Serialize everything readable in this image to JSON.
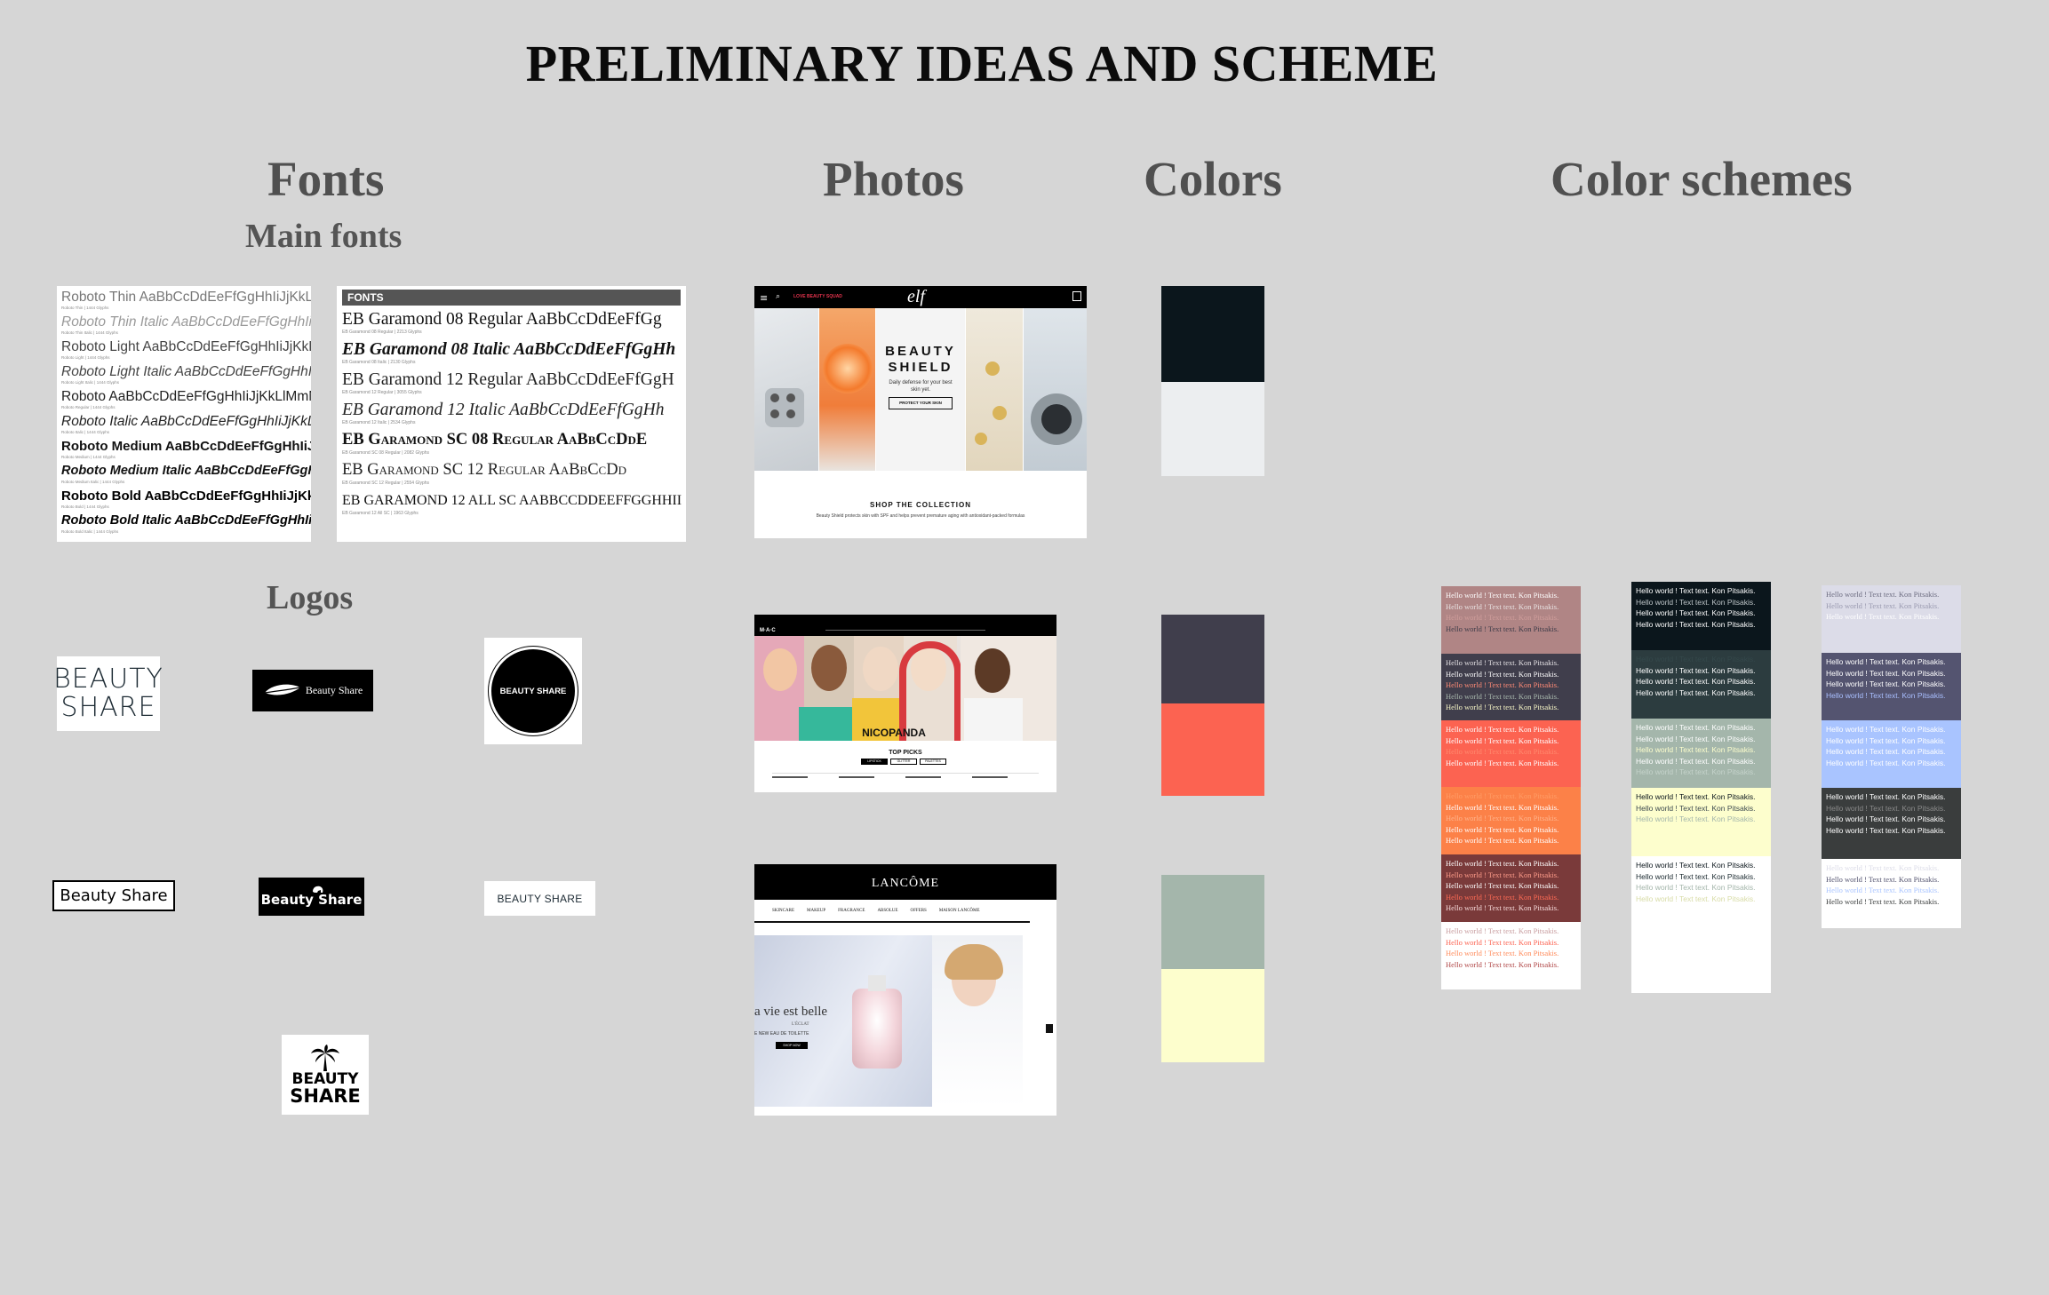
{
  "title": "PRELIMINARY IDEAS AND SCHEME",
  "sections": {
    "fonts": "Fonts",
    "main_fonts": "Main fonts",
    "logos": "Logos",
    "photos": "Photos",
    "colors": "Colors",
    "color_schemes": "Color schemes"
  },
  "roboto_card": {
    "lines": [
      {
        "text": "Roboto Thin AaBbCcDdEeFfGgHhIiJjKkLlM",
        "meta": "Roboto Thin | 1444 Glyphs"
      },
      {
        "text": "Roboto Thin Italic AaBbCcDdEeFfGgHhIiJjKk",
        "meta": "Roboto Thin Italic | 1444 Glyphs"
      },
      {
        "text": "Roboto Light AaBbCcDdEeFfGgHhIiJjKkLlM",
        "meta": "Roboto Light | 1444 Glyphs"
      },
      {
        "text": "Roboto Light Italic AaBbCcDdEeFfGgHhIiJjKkL",
        "meta": "Roboto Light Italic | 1444 Glyphs"
      },
      {
        "text": "Roboto AaBbCcDdEeFfGgHhIiJjKkLlMmNn",
        "meta": "Roboto Regular | 1444 Glyphs"
      },
      {
        "text": "Roboto Italic AaBbCcDdEeFfGgHhIiJjKkLlMm",
        "meta": "Roboto Italic | 1444 Glyphs"
      },
      {
        "text": "Roboto Medium AaBbCcDdEeFfGgHhIiJjKk",
        "meta": "Roboto Medium | 1444 Glyphs"
      },
      {
        "text": "Roboto Medium Italic AaBbCcDdEeFfGgHhIiJ",
        "meta": "Roboto Medium Italic | 1444 Glyphs"
      },
      {
        "text": "Roboto Bold AaBbCcDdEeFfGgHhIiJjKkLl",
        "meta": "Roboto Bold | 1444 Glyphs"
      },
      {
        "text": "Roboto Bold Italic AaBbCcDdEeFfGgHhIiJjKk",
        "meta": "Roboto Bold Italic | 1444 Glyphs"
      }
    ]
  },
  "eb_card": {
    "header": "FONTS",
    "lines": [
      {
        "text": "EB Garamond 08 Regular AaBbCcDdEeFfGg",
        "meta": "EB Garamond 08 Regular | 2213 Glyphs"
      },
      {
        "text": "EB Garamond 08 Italic AaBbCcDdEeFfGgHh",
        "meta": "EB Garamond 08 Italic | 2130 Glyphs"
      },
      {
        "text": "EB Garamond 12 Regular AaBbCcDdEeFfGgH",
        "meta": "EB Garamond 12 Regular | 3055 Glyphs"
      },
      {
        "text": "EB Garamond 12 Italic AaBbCcDdEeFfGgHh",
        "meta": "EB Garamond 12 Italic | 2534 Glyphs"
      },
      {
        "text": "EB Garamond SC 08 Regular AaBbCcDdE",
        "meta": "EB Garamond SC 08 Regular | 2082 Glyphs"
      },
      {
        "text": "EB Garamond SC 12 Regular AaBbCcDd",
        "meta": "EB Garamond SC 12 Regular | 2554 Glyphs"
      },
      {
        "text": "EB GARAMOND 12 ALL SC AABBCCDDEEFFGGHHII",
        "meta": "EB Garamond 12 All SC | 1963 Glyphs"
      }
    ]
  },
  "logos": {
    "logo1": "BEAUTY\nSHARE",
    "logo2": "Beauty Share",
    "logo3": "BEAUTY SHARE",
    "logo4": "Beauty Share",
    "logo5": "Beauty Share",
    "logo6": "BEAUTY SHARE",
    "logo7_line1": "BEAUTY",
    "logo7_line2": "SHARE"
  },
  "photos": {
    "elf": {
      "brand": "elf",
      "nav_link": "LOVE BEAUTY SQUAD",
      "headline1": "BEAUTY",
      "headline2": "SHIELD",
      "tagline": "Daily defense for your best skin yet.",
      "cta": "PROTECT YOUR SKIN",
      "shop": "SHOP THE COLLECTION",
      "desc": "Beauty Shield protects skin with SPF and helps prevent premature aging with antioxidant-packed formulas"
    },
    "mac": {
      "brand": "M·A·C",
      "campaign": "NICOPANDA",
      "section": "TOP PICKS",
      "tabs": [
        "LIPSTICK",
        "GLITTER",
        "PALETTES"
      ]
    },
    "lancome": {
      "brand": "LANCÔME",
      "nav": [
        "SKINCARE",
        "MAKEUP",
        "FRAGRANCE",
        "ABSOLUE",
        "OFFERS",
        "MAISON LANCÔME"
      ],
      "headline": "a vie est belle",
      "subline": "L'ÉCLAT",
      "tagline": "E NEW EAU DE TOILETTE",
      "cta": "SHOP NOW"
    }
  },
  "colors": [
    {
      "hex": "#0b161c"
    },
    {
      "hex": "#eceef0"
    },
    {
      "hex": "#403e4c"
    },
    {
      "hex": "#fc6351"
    },
    {
      "hex": "#a4b6ab"
    },
    {
      "hex": "#fdfecd"
    }
  ],
  "schemes": {
    "sample_text": "Hello world ! Text text. Kon Pitsakis.",
    "col1": [
      {
        "bg": "#b08585",
        "font": "serif",
        "colors": [
          "#ffffff",
          "#e8e2e2",
          "#cf9d9b",
          "#3d3b48"
        ]
      },
      {
        "bg": "#403e4c",
        "font": "serif",
        "colors": [
          "#e3e0e3",
          "#ffffff",
          "#ff8b76",
          "#a8b8ad",
          "#f9f8c8"
        ]
      },
      {
        "bg": "#fc6351",
        "font": "serif",
        "colors": [
          "#ffffff",
          "#ffffff",
          "#ff8a6e",
          "#ffffff"
        ]
      },
      {
        "bg": "#fc8148",
        "font": "serif",
        "colors": [
          "#ff9c66",
          "#ffffff",
          "#ffb48c",
          "#ffffff",
          "#ffffff"
        ]
      },
      {
        "bg": "#7a3a3a",
        "font": "serif",
        "colors": [
          "#ffffff",
          "#ff9c8a",
          "#ffffff",
          "#ff6b55",
          "#f6dada"
        ]
      },
      {
        "bg": "#ffffff",
        "font": "serif",
        "colors": [
          "#c99ea0",
          "#fc6351",
          "#ff8b5b",
          "#b04646"
        ]
      }
    ],
    "col2": [
      {
        "bg": "#0b161c",
        "font": "sans",
        "colors": [
          "#ffffff",
          "#bfc6c9",
          "#ffffff",
          "#ffffff"
        ]
      },
      {
        "bg": "#2c3c3f",
        "font": "sans",
        "colors": [
          "#34484b",
          "#ffffff",
          "#ffffff",
          "#ffffff"
        ]
      },
      {
        "bg": "#a4b6ab",
        "font": "sans",
        "colors": [
          "#ffffff",
          "#ffffff",
          "#fdfecd",
          "#ffffff",
          "#c5d3cb"
        ]
      },
      {
        "bg": "#fdfecd",
        "font": "sans",
        "colors": [
          "#0b161c",
          "#3d4a4f",
          "#a4b6ab"
        ]
      },
      {
        "bg": "#ffffff",
        "font": "sans",
        "colors": [
          "#0b161c",
          "#1b2a30",
          "#a4b6ab",
          "#d8dca7"
        ]
      },
      {
        "bg": "#ffffff",
        "font": "sans",
        "colors": []
      }
    ],
    "col3": [
      {
        "bg": "#dcdce8",
        "font": "serif",
        "colors": [
          "#6c6c80",
          "#9a9ab0",
          "#ffffff"
        ]
      },
      {
        "bg": "#545470",
        "font": "sans",
        "colors": [
          "#ffffff",
          "#ffffff",
          "#ffffff",
          "#a9bfff"
        ]
      },
      {
        "bg": "#a9c4ff",
        "font": "sans",
        "colors": [
          "#ffffff",
          "#ffffff",
          "#ffffff",
          "#ffffff"
        ]
      },
      {
        "bg": "#3a3d3d",
        "font": "sans",
        "colors": [
          "#ffffff",
          "#8a8a8a",
          "#ffffff",
          "#ffffff"
        ]
      },
      {
        "bg": "#ffffff",
        "font": "serif",
        "colors": [
          "#dcdce8",
          "#545470",
          "#a9c4ff",
          "#3a3d3d"
        ]
      }
    ]
  }
}
